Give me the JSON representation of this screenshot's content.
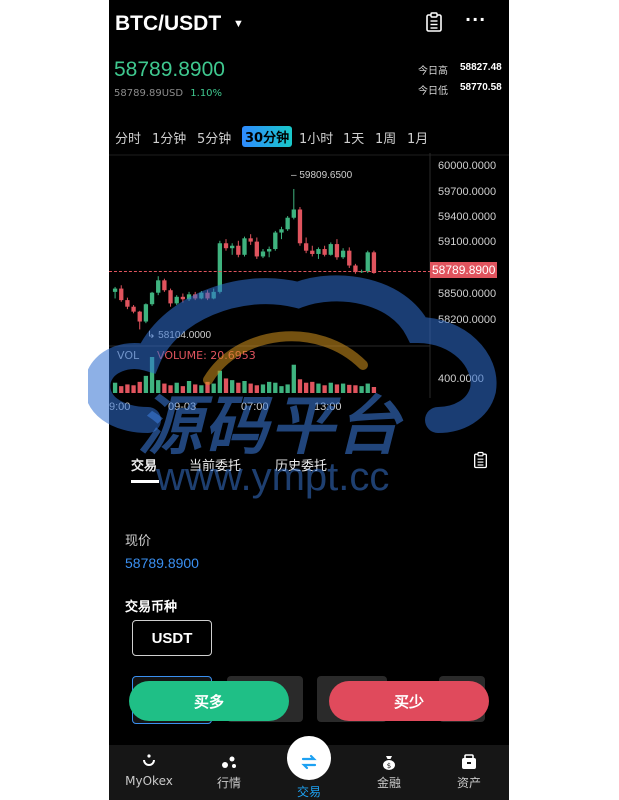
{
  "header": {
    "pair": "BTC/USDT",
    "dropdown_icon": "caret-down-icon",
    "orders_icon": "clipboard-icon",
    "more_icon": "more-horizontal-icon"
  },
  "ticker": {
    "last_price": "58789.8900",
    "sub_price": "58789.89USD",
    "change_pct": "1.10%",
    "high_label": "今日高",
    "high_value": "58827.48",
    "low_label": "今日低",
    "low_value": "58770.58"
  },
  "timeframes": [
    "分时",
    "1分钟",
    "5分钟",
    "30分钟",
    "1小时",
    "1天",
    "1周",
    "1月"
  ],
  "active_timeframe": "30分钟",
  "chart_data": {
    "type": "candlestick",
    "y_ticks": [
      "60000.0000",
      "59700.0000",
      "59400.0000",
      "59100.0000",
      "58500.0000",
      "58200.0000"
    ],
    "current_price_label": "58789.8900",
    "max_label": "59809.6500",
    "min_label": "58104.0000",
    "x_ticks": [
      "9:00",
      "09-03",
      "07:00",
      "13:00"
    ],
    "volume_label": "VOL",
    "volume_value": "VOLUME: 20.6953",
    "volume_tick": "400.0000",
    "ylim": [
      58000,
      60100
    ],
    "candles": [
      {
        "o": 58560,
        "h": 58620,
        "l": 58480,
        "c": 58600
      },
      {
        "o": 58600,
        "h": 58640,
        "l": 58440,
        "c": 58460
      },
      {
        "o": 58460,
        "h": 58490,
        "l": 58350,
        "c": 58380
      },
      {
        "o": 58380,
        "h": 58400,
        "l": 58300,
        "c": 58320
      },
      {
        "o": 58320,
        "h": 58330,
        "l": 58104,
        "c": 58200
      },
      {
        "o": 58200,
        "h": 58420,
        "l": 58180,
        "c": 58410
      },
      {
        "o": 58410,
        "h": 58560,
        "l": 58390,
        "c": 58550
      },
      {
        "o": 58550,
        "h": 58750,
        "l": 58520,
        "c": 58700
      },
      {
        "o": 58700,
        "h": 58720,
        "l": 58560,
        "c": 58580
      },
      {
        "o": 58580,
        "h": 58600,
        "l": 58380,
        "c": 58420
      },
      {
        "o": 58420,
        "h": 58520,
        "l": 58400,
        "c": 58500
      },
      {
        "o": 58500,
        "h": 58540,
        "l": 58430,
        "c": 58470
      },
      {
        "o": 58470,
        "h": 58560,
        "l": 58450,
        "c": 58530
      },
      {
        "o": 58530,
        "h": 58560,
        "l": 58460,
        "c": 58480
      },
      {
        "o": 58480,
        "h": 58570,
        "l": 58470,
        "c": 58550
      },
      {
        "o": 58550,
        "h": 58580,
        "l": 58460,
        "c": 58480
      },
      {
        "o": 58480,
        "h": 58600,
        "l": 58470,
        "c": 58560
      },
      {
        "o": 58560,
        "h": 59180,
        "l": 58540,
        "c": 59150
      },
      {
        "o": 59150,
        "h": 59200,
        "l": 59060,
        "c": 59090
      },
      {
        "o": 59090,
        "h": 59150,
        "l": 59010,
        "c": 59120
      },
      {
        "o": 59120,
        "h": 59180,
        "l": 58980,
        "c": 59010
      },
      {
        "o": 59010,
        "h": 59230,
        "l": 58990,
        "c": 59210
      },
      {
        "o": 59210,
        "h": 59260,
        "l": 59130,
        "c": 59170
      },
      {
        "o": 59170,
        "h": 59220,
        "l": 58960,
        "c": 58990
      },
      {
        "o": 58990,
        "h": 59080,
        "l": 58970,
        "c": 59050
      },
      {
        "o": 59050,
        "h": 59110,
        "l": 58980,
        "c": 59080
      },
      {
        "o": 59080,
        "h": 59300,
        "l": 59060,
        "c": 59280
      },
      {
        "o": 59280,
        "h": 59350,
        "l": 59200,
        "c": 59320
      },
      {
        "o": 59320,
        "h": 59480,
        "l": 59300,
        "c": 59460
      },
      {
        "o": 59460,
        "h": 59809,
        "l": 59440,
        "c": 59560
      },
      {
        "o": 59560,
        "h": 59590,
        "l": 59120,
        "c": 59150
      },
      {
        "o": 59150,
        "h": 59220,
        "l": 59030,
        "c": 59060
      },
      {
        "o": 59060,
        "h": 59120,
        "l": 58990,
        "c": 59020
      },
      {
        "o": 59020,
        "h": 59100,
        "l": 58960,
        "c": 59080
      },
      {
        "o": 59080,
        "h": 59120,
        "l": 58990,
        "c": 59010
      },
      {
        "o": 59010,
        "h": 59160,
        "l": 59000,
        "c": 59140
      },
      {
        "o": 59140,
        "h": 59200,
        "l": 58950,
        "c": 58980
      },
      {
        "o": 58980,
        "h": 59090,
        "l": 58960,
        "c": 59060
      },
      {
        "o": 59060,
        "h": 59100,
        "l": 58850,
        "c": 58880
      },
      {
        "o": 58880,
        "h": 58900,
        "l": 58780,
        "c": 58800
      },
      {
        "o": 58800,
        "h": 58830,
        "l": 58790,
        "c": 58810
      },
      {
        "o": 58810,
        "h": 59060,
        "l": 58790,
        "c": 59040
      },
      {
        "o": 59040,
        "h": 59060,
        "l": 58780,
        "c": 58789
      }
    ],
    "volumes": [
      120,
      80,
      100,
      90,
      130,
      200,
      420,
      150,
      110,
      90,
      120,
      80,
      140,
      100,
      90,
      130,
      110,
      260,
      170,
      150,
      120,
      140,
      110,
      90,
      100,
      130,
      120,
      80,
      100,
      330,
      160,
      120,
      130,
      110,
      90,
      120,
      100,
      110,
      95,
      90,
      80,
      110,
      70
    ]
  },
  "order_tabs": {
    "trade": "交易",
    "current_orders": "当前委托",
    "history_orders": "历史委托"
  },
  "form": {
    "current_price_label": "现价",
    "current_price_value": "58789.8900",
    "currency_label": "交易币种",
    "currency_value": "USDT"
  },
  "actions": {
    "buy": "买多",
    "sell": "买少"
  },
  "bottom_nav": [
    {
      "label": "MyOkex",
      "icon": "home-icon"
    },
    {
      "label": "行情",
      "icon": "market-icon"
    },
    {
      "label": "交易",
      "icon": "swap-icon"
    },
    {
      "label": "金融",
      "icon": "money-bag-icon"
    },
    {
      "label": "资产",
      "icon": "wallet-icon"
    }
  ],
  "watermark": {
    "brand": "源码平台",
    "url": "www.ympt.cc"
  },
  "colors": {
    "up": "#3fb37f",
    "down": "#e0545e",
    "accent_blue": "#3a8ff0",
    "buy_button": "#1fbf86",
    "sell_button": "#e04a5c"
  }
}
